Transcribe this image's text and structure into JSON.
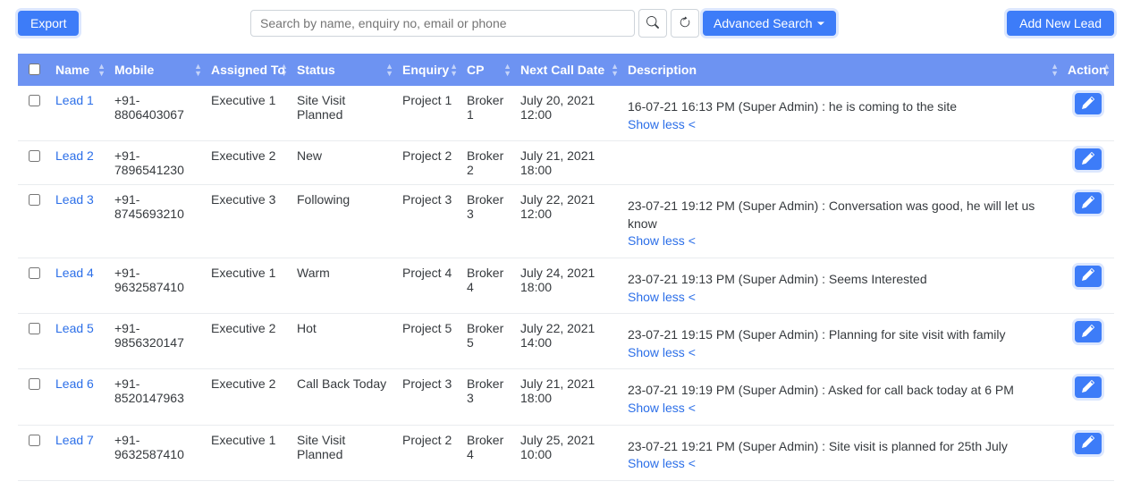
{
  "toolbar": {
    "export_label": "Export",
    "search_placeholder": "Search by name, enquiry no, email or phone",
    "advanced_search_label": "Advanced Search",
    "add_new_lead_label": "Add New Lead"
  },
  "table": {
    "headers": {
      "name": "Name",
      "mobile": "Mobile",
      "assigned_to": "Assigned To",
      "status": "Status",
      "enquiry": "Enquiry",
      "cp": "CP",
      "next_call": "Next Call Date",
      "description": "Description",
      "action": "Action"
    },
    "show_less_label": "Show less <",
    "rows": [
      {
        "name": "Lead 1",
        "mobile": "+91-8806403067",
        "assigned_to": "Executive 1",
        "status": "Site Visit Planned",
        "enquiry": "Project 1",
        "cp": "Broker 1",
        "next_call": "July 20, 2021 12:00",
        "description": "16-07-21 16:13 PM (Super Admin) : he is coming to the site"
      },
      {
        "name": "Lead 2",
        "mobile": "+91-7896541230",
        "assigned_to": "Executive 2",
        "status": "New",
        "enquiry": "Project 2",
        "cp": "Broker 2",
        "next_call": "July 21, 2021 18:00",
        "description": ""
      },
      {
        "name": "Lead 3",
        "mobile": "+91-8745693210",
        "assigned_to": "Executive 3",
        "status": "Following",
        "enquiry": "Project 3",
        "cp": "Broker 3",
        "next_call": "July 22, 2021 12:00",
        "description": "23-07-21 19:12 PM (Super Admin) : Conversation was good, he will let us know"
      },
      {
        "name": "Lead 4",
        "mobile": "+91-9632587410",
        "assigned_to": "Executive 1",
        "status": "Warm",
        "enquiry": "Project 4",
        "cp": "Broker 4",
        "next_call": "July 24, 2021 18:00",
        "description": "23-07-21 19:13 PM (Super Admin) : Seems Interested"
      },
      {
        "name": "Lead 5",
        "mobile": "+91-9856320147",
        "assigned_to": "Executive 2",
        "status": "Hot",
        "enquiry": "Project 5",
        "cp": "Broker 5",
        "next_call": "July 22, 2021 14:00",
        "description": "23-07-21 19:15 PM (Super Admin) : Planning for site visit with family"
      },
      {
        "name": "Lead 6",
        "mobile": "+91-8520147963",
        "assigned_to": "Executive 2",
        "status": "Call Back Today",
        "enquiry": "Project 3",
        "cp": "Broker 3",
        "next_call": "July 21, 2021 18:00",
        "description": "23-07-21 19:19 PM (Super Admin) : Asked for call back today at 6 PM"
      },
      {
        "name": "Lead 7",
        "mobile": "+91-9632587410",
        "assigned_to": "Executive 1",
        "status": "Site Visit Planned",
        "enquiry": "Project 2",
        "cp": "Broker 4",
        "next_call": "July 25, 2021 10:00",
        "description": "23-07-21 19:21 PM (Super Admin) : Site visit is planned for 25th July"
      }
    ]
  }
}
